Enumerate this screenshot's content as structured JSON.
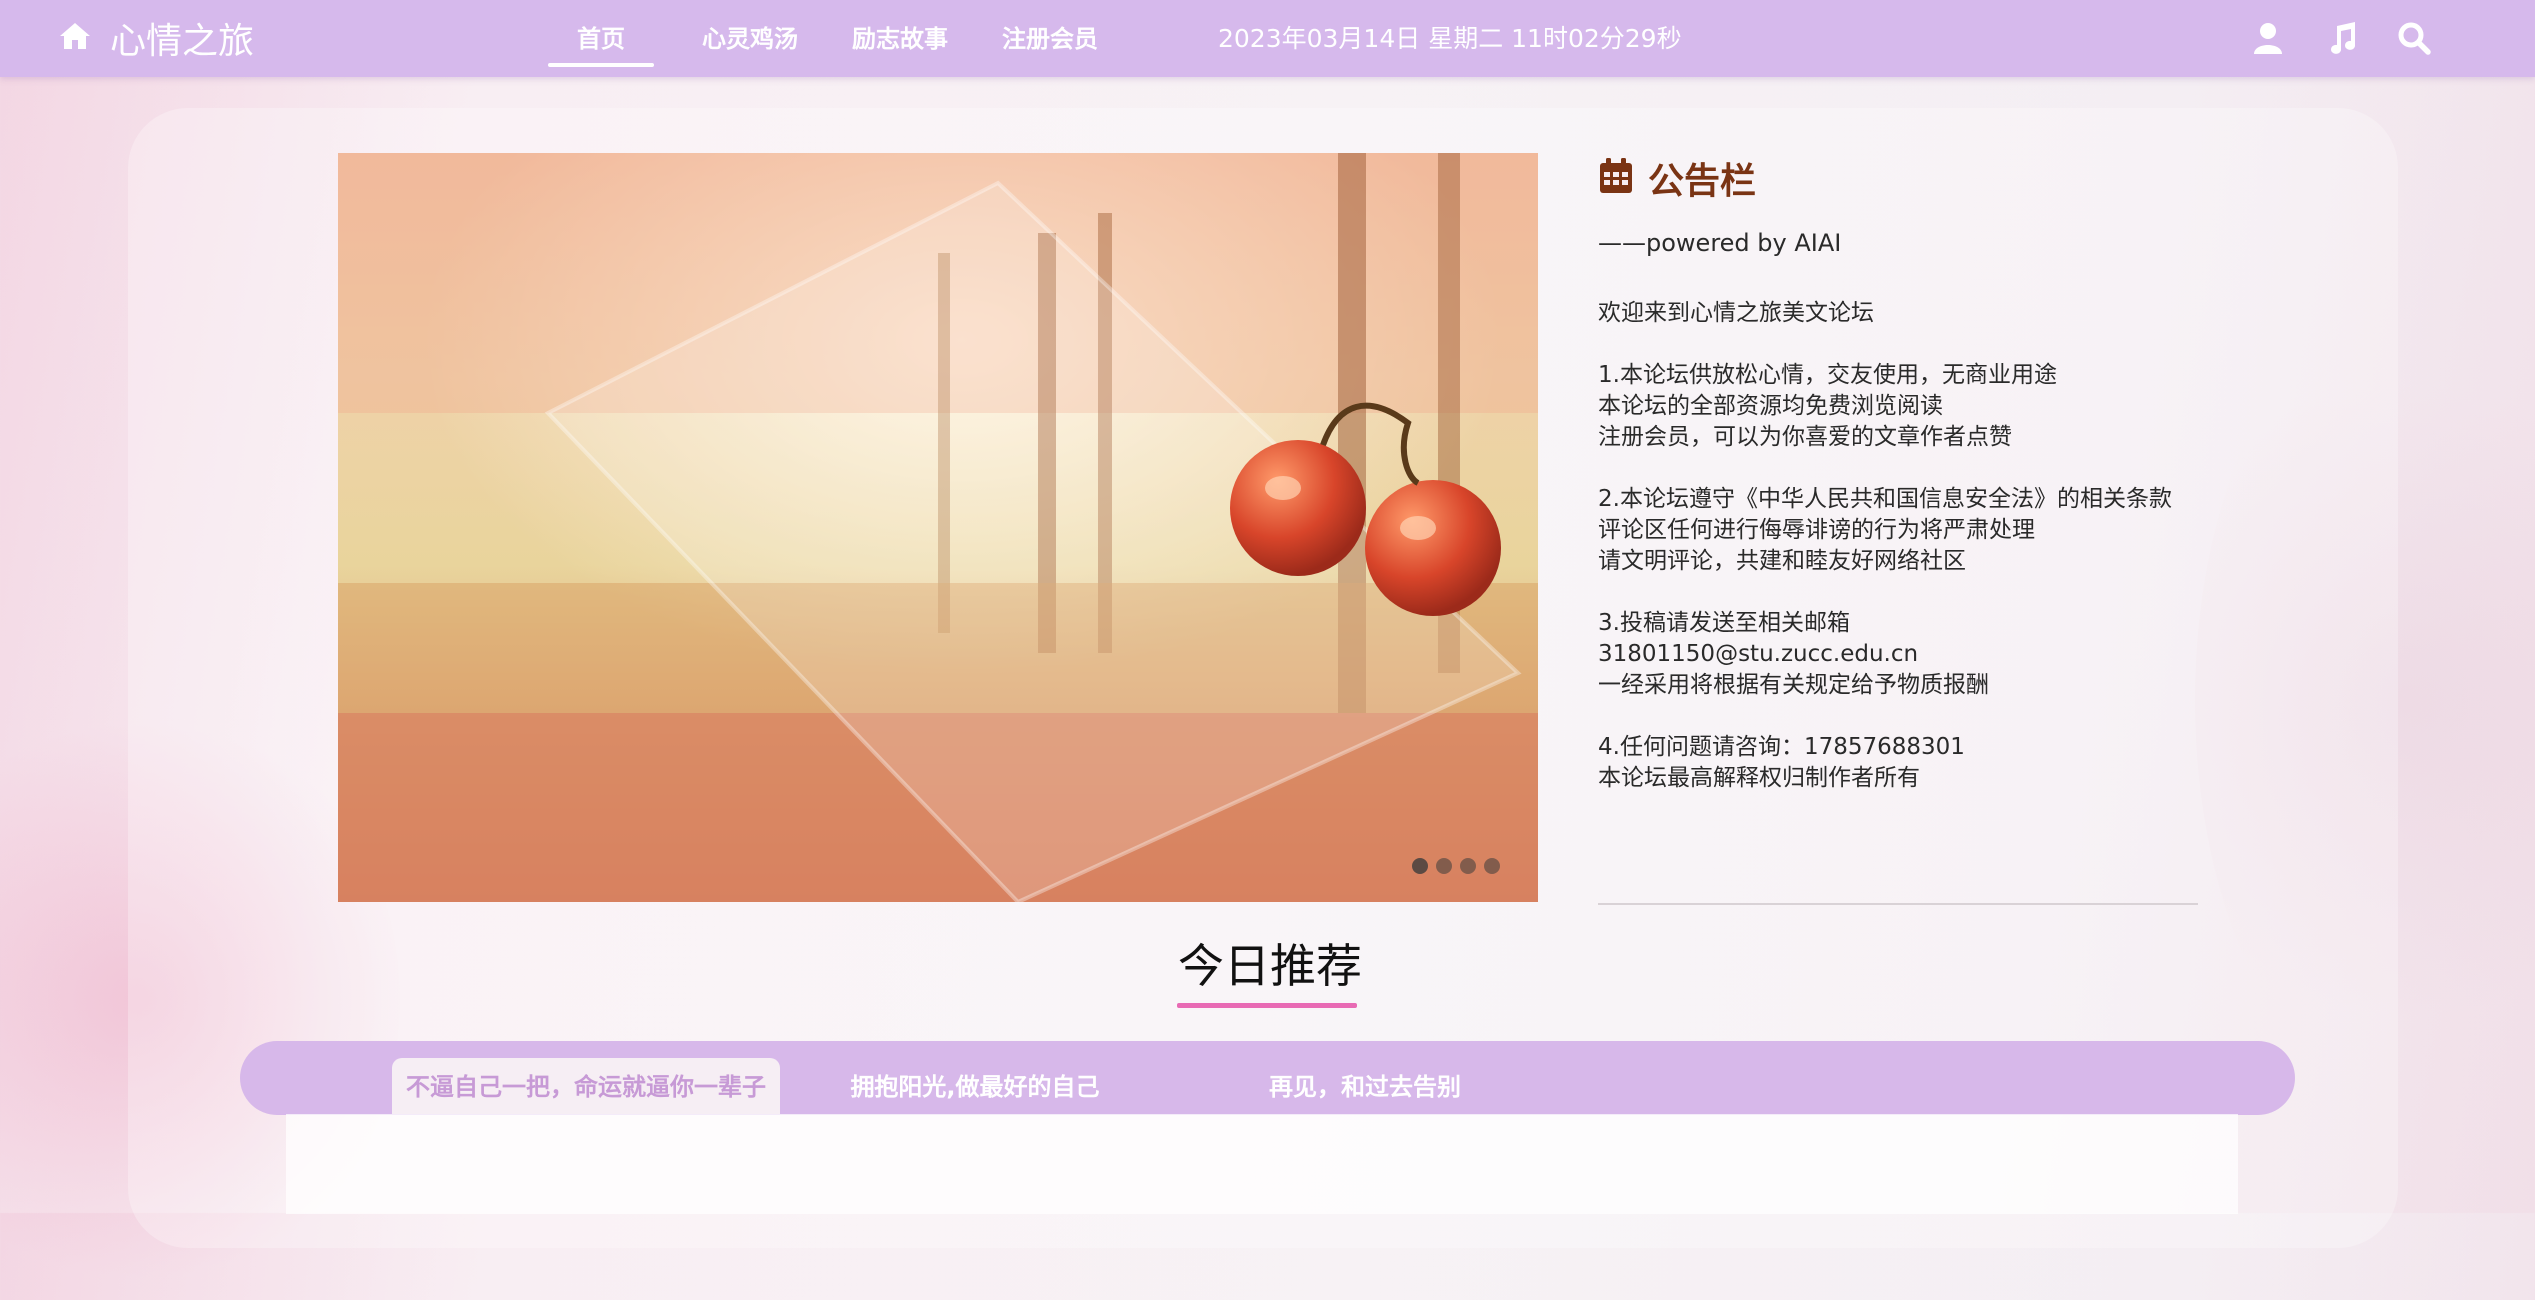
{
  "nav": {
    "brand": "心情之旅",
    "links": [
      "首页",
      "心灵鸡汤",
      "励志故事",
      "注册会员"
    ],
    "datetime": "2023年03月14日  星期二  11时02分29秒",
    "icons": [
      "home-icon",
      "user-icon",
      "music-icon",
      "search-icon"
    ]
  },
  "carousel": {
    "slide_count": 4,
    "active_index": 0
  },
  "notice": {
    "title": "公告栏",
    "subtitle": "——powered by AIAI",
    "lines": [
      "欢迎来到心情之旅美文论坛",
      "",
      "1.本论坛供放松心情，交友使用，无商业用途",
      "本论坛的全部资源均免费浏览阅读",
      "注册会员，可以为你喜爱的文章作者点赞",
      "",
      "2.本论坛遵守《中华人民共和国信息安全法》的相关条款",
      "评论区任何进行侮辱诽谤的行为将严肃处理",
      "请文明评论，共建和睦友好网络社区",
      "",
      "3.投稿请发送至相关邮箱",
      "31801150@stu.zucc.edu.cn",
      "一经采用将根据有关规定给予物质报酬",
      "",
      "4.任何问题请咨询：17857688301",
      "本论坛最高解释权归制作者所有"
    ]
  },
  "recommend": {
    "title": "今日推荐",
    "tabs": [
      "不逼自己一把，命运就逼你一辈子",
      "拥抱阳光,做最好的自己",
      "再见，和过去告别"
    ],
    "active_tab": 0
  },
  "colors": {
    "nav_bg": "#d6b9ec",
    "notice_title": "#7a3414",
    "underline": "#e86ab4",
    "active_tab_text": "#c79ad6"
  }
}
